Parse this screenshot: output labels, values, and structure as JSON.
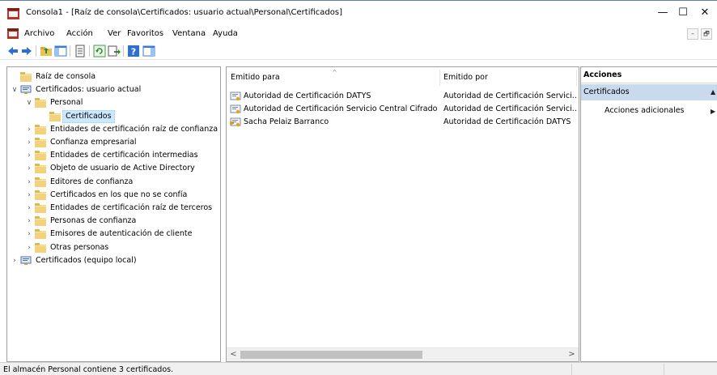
{
  "window": {
    "title": "Consola1 - [Raíz de consola\\Certificados: usuario actual\\Personal\\Certificados]",
    "minimize": "—",
    "maximize": "☐",
    "close": "✕"
  },
  "menubar": {
    "items": [
      "Archivo",
      "Acción",
      "Ver",
      "Favoritos",
      "Ventana",
      "Ayuda"
    ],
    "mdi_minimize": "–",
    "mdi_restore": "🗗"
  },
  "toolbar": {
    "buttons": [
      "back-icon",
      "forward-icon",
      "up-folder-icon",
      "show-hide-tree-icon",
      "properties-icon",
      "refresh-icon",
      "export-list-icon",
      "help-icon",
      "show-hide-action-pane-icon"
    ]
  },
  "tree": {
    "items": [
      {
        "label": "Raíz de consola",
        "level": 0,
        "expander": "",
        "icon": "folder-icon"
      },
      {
        "label": "Certificados: usuario actual",
        "level": 0,
        "expander": "∨",
        "icon": "certificate-store-icon"
      },
      {
        "label": "Personal",
        "level": 1,
        "expander": "∨",
        "icon": "folder-icon"
      },
      {
        "label": "Certificados",
        "level": 2,
        "expander": "",
        "icon": "folder-icon",
        "selected": true
      },
      {
        "label": "Entidades de certificación raíz de confianza",
        "level": 1,
        "expander": "›",
        "icon": "folder-icon"
      },
      {
        "label": "Confianza empresarial",
        "level": 1,
        "expander": "›",
        "icon": "folder-icon"
      },
      {
        "label": "Entidades de certificación intermedias",
        "level": 1,
        "expander": "›",
        "icon": "folder-icon"
      },
      {
        "label": "Objeto de usuario de Active Directory",
        "level": 1,
        "expander": "›",
        "icon": "folder-icon"
      },
      {
        "label": "Editores de confianza",
        "level": 1,
        "expander": "›",
        "icon": "folder-icon"
      },
      {
        "label": "Certificados en los que no se confía",
        "level": 1,
        "expander": "›",
        "icon": "folder-icon"
      },
      {
        "label": "Entidades de certificación raíz de terceros",
        "level": 1,
        "expander": "›",
        "icon": "folder-icon"
      },
      {
        "label": "Personas de confianza",
        "level": 1,
        "expander": "›",
        "icon": "folder-icon"
      },
      {
        "label": "Emisores de autenticación de cliente",
        "level": 1,
        "expander": "›",
        "icon": "folder-icon"
      },
      {
        "label": "Otras personas",
        "level": 1,
        "expander": "›",
        "icon": "folder-icon"
      },
      {
        "label": "Certificados (equipo local)",
        "level": 0,
        "expander": "›",
        "icon": "certificate-store-icon"
      }
    ]
  },
  "list": {
    "columns": [
      "Emitido para",
      "Emitido por"
    ],
    "sort_indicator": "^",
    "rows": [
      {
        "issued_to": "Autoridad de Certificación DATYS",
        "issued_by": "Autoridad de Certificación Servici...",
        "icon": "certificate-icon"
      },
      {
        "issued_to": "Autoridad de Certificación Servicio Central Cifrado",
        "issued_by": "Autoridad de Certificación Servici...",
        "icon": "certificate-icon"
      },
      {
        "issued_to": "Sacha Pelaiz Barranco",
        "issued_by": "Autoridad de Certificación DATYS",
        "icon": "certificate-key-icon"
      }
    ],
    "scroll_left": "<",
    "scroll_right": ">"
  },
  "actions": {
    "title": "Acciones",
    "section": "Certificados",
    "section_caret": "▲",
    "item": "Acciones adicionales",
    "item_caret": "▶"
  },
  "status": {
    "text": "El almacén Personal contiene 3 certificados."
  }
}
